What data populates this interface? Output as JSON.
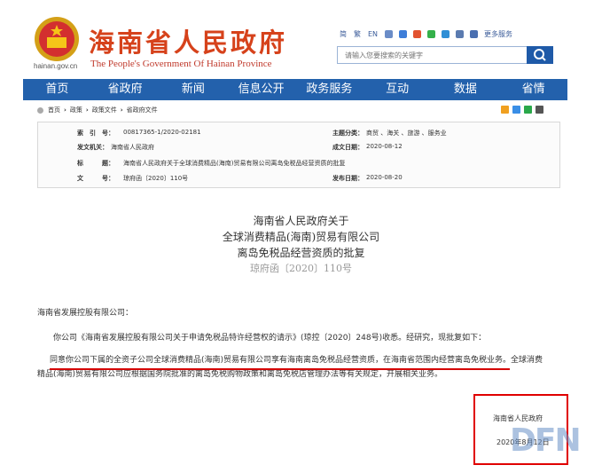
{
  "header": {
    "site_title": "海南省人民政府",
    "site_subtitle": "The People's Government Of Hainan Province",
    "site_url": "hainan.gov.cn",
    "toplinks": [
      "简",
      "繁",
      "EN"
    ],
    "more_label": "更多服务",
    "search_placeholder": "请输入您要搜索的关键字"
  },
  "nav": {
    "items": [
      "首页",
      "省政府",
      "新闻",
      "信息公开",
      "政务服务",
      "互动",
      "数据",
      "省情"
    ]
  },
  "breadcrumb": {
    "items": [
      "首页",
      "政策",
      "政策文件",
      "省政府文件"
    ]
  },
  "meta": {
    "index_label": "索　引　号：",
    "index_value": "00817365-1/2020-02181",
    "topic_label": "主题分类：",
    "topic_value": "商贸 、海关 、旅游 、服务业",
    "issuer_label": "发文机关：",
    "issuer_value": "海南省人民政府",
    "date_label": "成文日期：",
    "date_value": "2020-08-12",
    "title_label": "标　　　题：",
    "title_value": "海南省人民政府关于全球消费精品(海南)贸易有限公司离岛免税品经营资质的批复",
    "docno_label": "文　　　号：",
    "docno_value": "琼府函〔2020〕110号",
    "pub_label": "发布日期：",
    "pub_value": "2020-08-20"
  },
  "document": {
    "title_line1": "海南省人民政府关于",
    "title_line2": "全球消费精品(海南)贸易有限公司",
    "title_line3": "离岛免税品经营资质的批复",
    "number": "琼府函〔2020〕110号",
    "addressee": "海南省发展控股有限公司：",
    "para1": "你公司《海南省发展控股有限公司关于申请免税品特许经营权的请示》(琼控〔2020〕248号)收悉。经研究，现批复如下：",
    "para2_line1": "同意你公司下属的全资子公司全球消费精品(海南)贸易有限公司享有海南离岛免税品经营资质，在海南省范围内经营离岛免税业务。全球消费",
    "para2_line2": "精品(海南)贸易有限公司应根据国务院批准的离岛免税购物政策和离岛免税店管理办法等有关规定，开展相关业务。",
    "signer": "海南省人民政府",
    "sign_date": "2020年8月12日"
  },
  "watermark": "DFN",
  "colors": {
    "nav_bg": "#2361ac",
    "title_red": "#d6421b",
    "highlight_red": "#d40000"
  }
}
